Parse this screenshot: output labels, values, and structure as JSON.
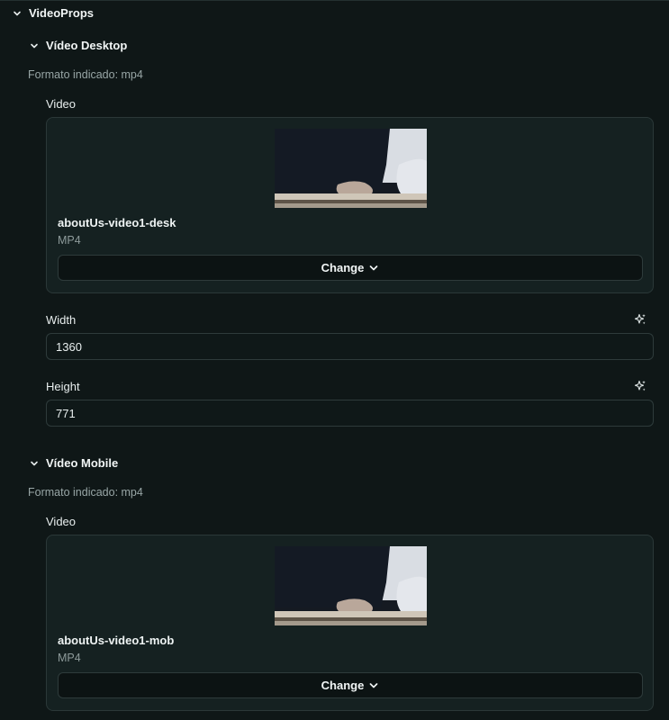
{
  "root_section": {
    "title": "VideoProps"
  },
  "desktop": {
    "title": "Vídeo Desktop",
    "hint": "Formato indicado: mp4",
    "video_label": "Video",
    "file_name": "aboutUs-video1-desk",
    "file_type": "MP4",
    "change_label": "Change",
    "width_label": "Width",
    "width_value": "1360",
    "height_label": "Height",
    "height_value": "771"
  },
  "mobile": {
    "title": "Vídeo Mobile",
    "hint": "Formato indicado: mp4",
    "video_label": "Video",
    "file_name": "aboutUs-video1-mob",
    "file_type": "MP4",
    "change_label": "Change"
  },
  "icons": {
    "section_toggle": "chevron-down-icon",
    "ai_assist": "sparkles-icon",
    "dropdown": "chevron-down-icon"
  },
  "colors": {
    "background": "#0f1717",
    "card": "#152121",
    "border": "#2b3838",
    "button_bg": "#0c1313"
  }
}
